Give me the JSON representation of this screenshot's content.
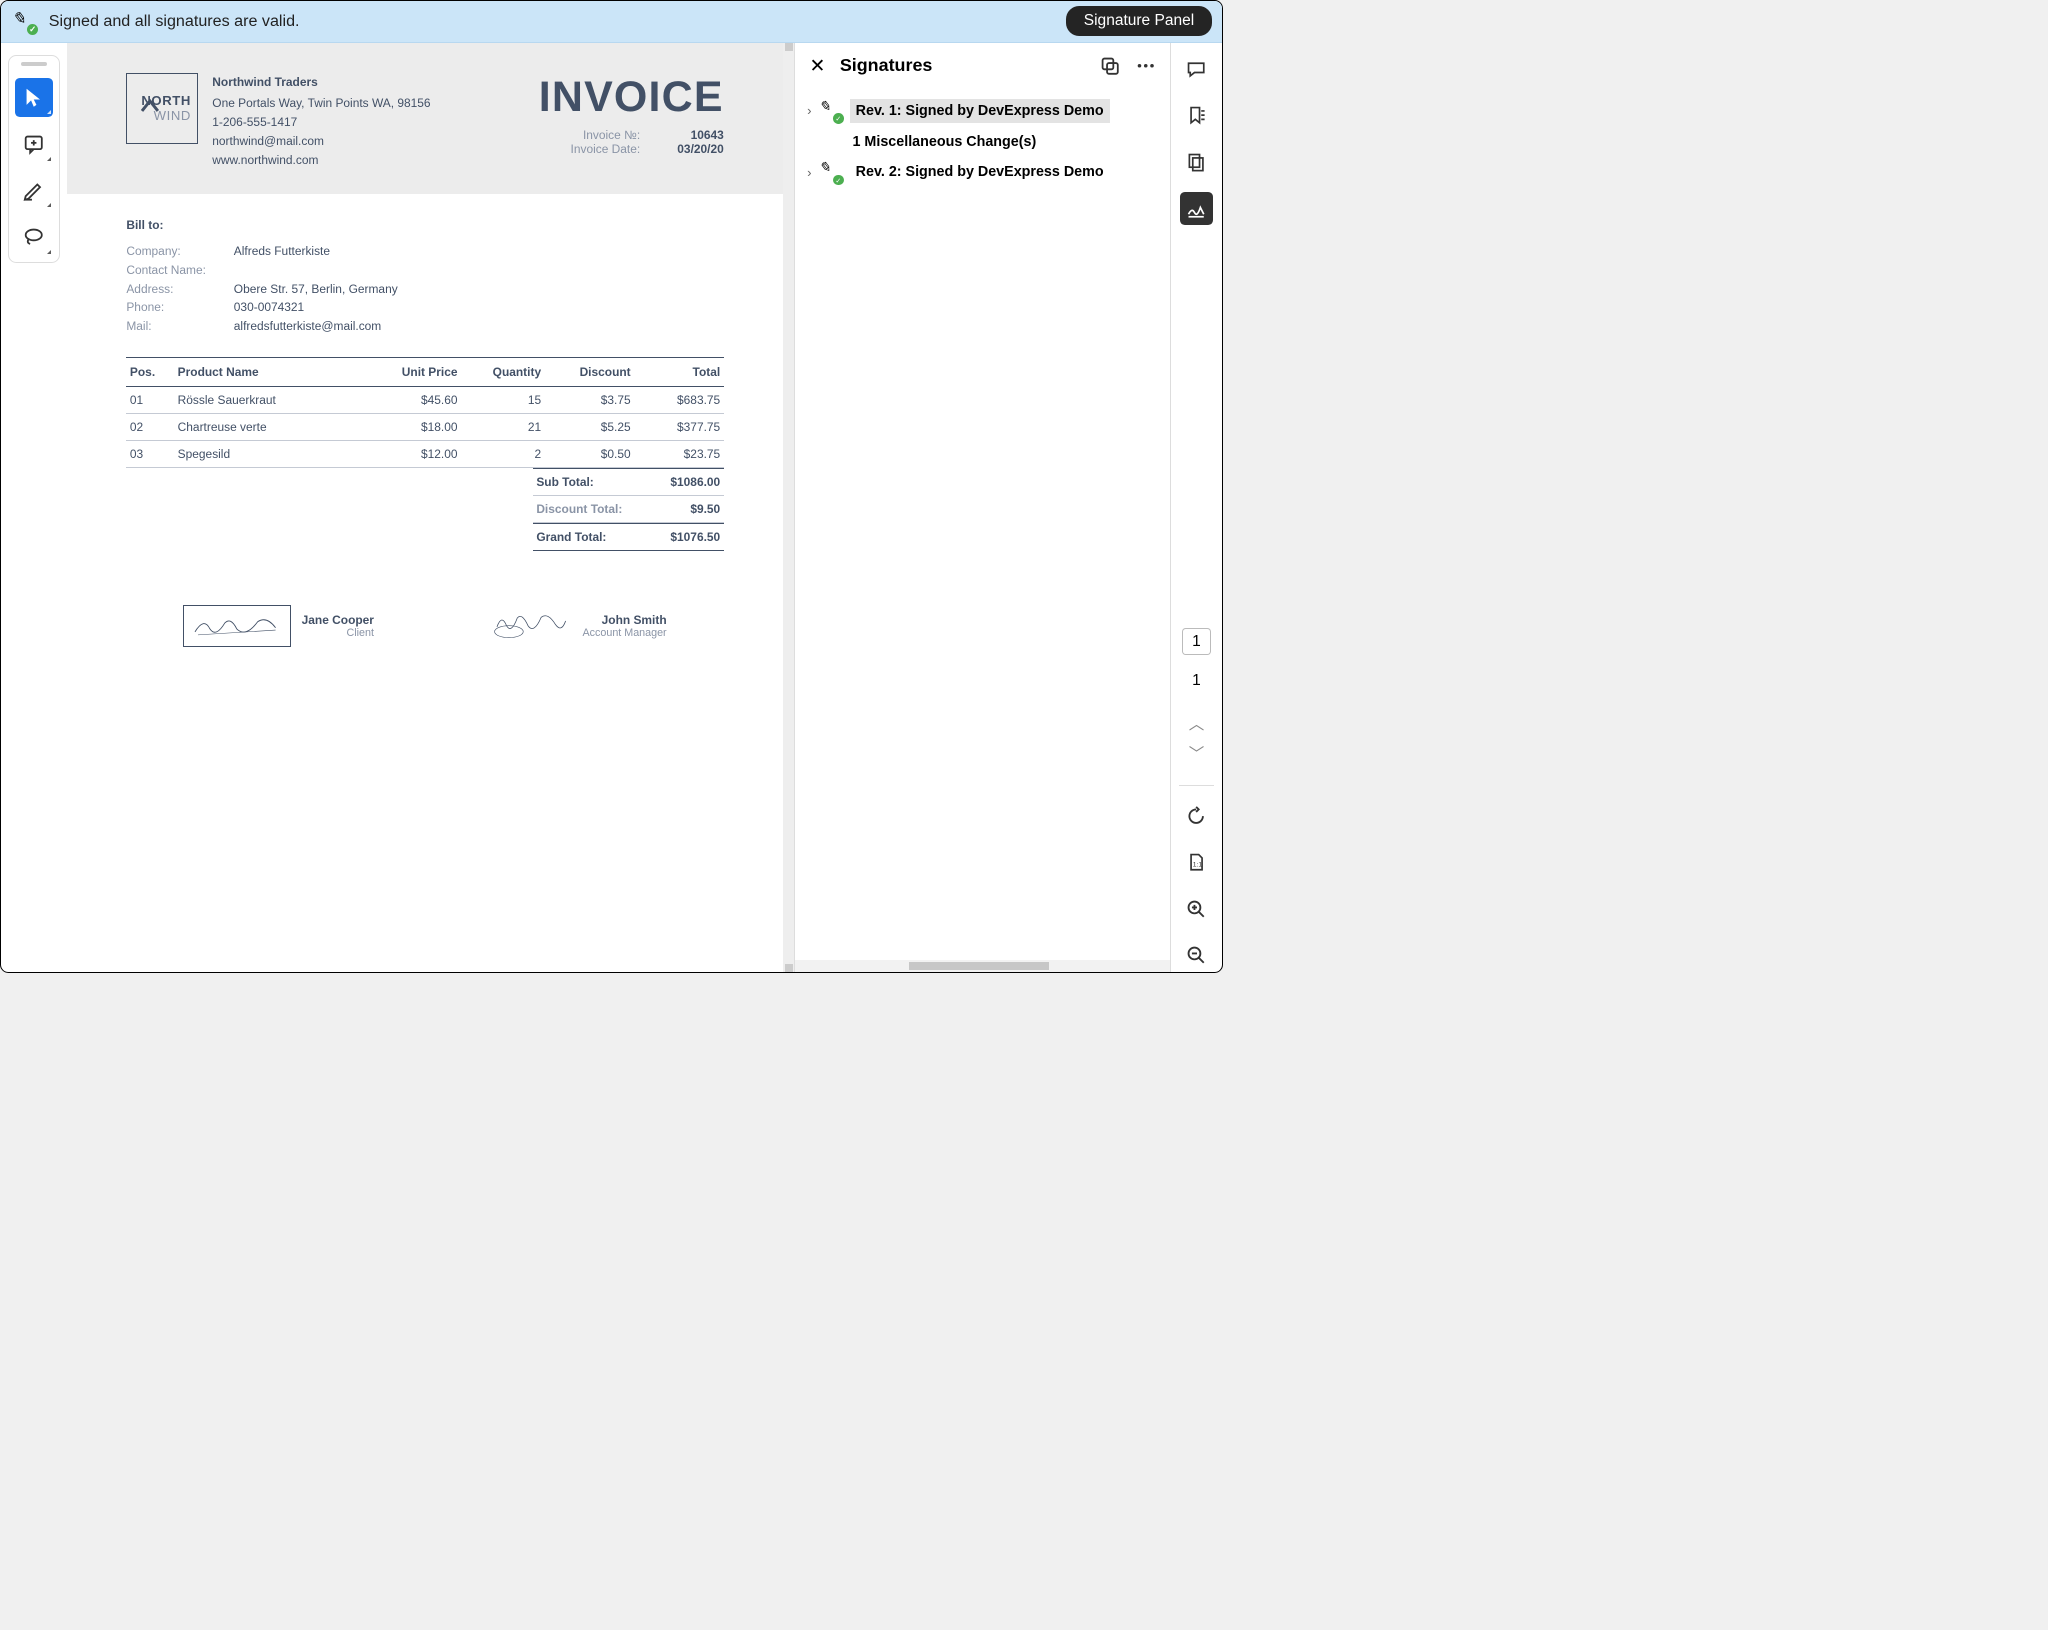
{
  "signature_bar": {
    "status": "Signed and all signatures are valid.",
    "panel_button": "Signature Panel"
  },
  "tools": [
    "select",
    "comment",
    "highlight",
    "lasso"
  ],
  "document": {
    "company": {
      "logo_line1": "NORTH",
      "logo_line2": "WIND",
      "name": "Northwind Traders",
      "address": "One Portals Way, Twin Points WA, 98156",
      "phone": "1-206-555-1417",
      "email": "northwind@mail.com",
      "website": "www.northwind.com"
    },
    "invoice_title": "INVOICE",
    "invoice_meta": {
      "number_label": "Invoice №:",
      "number": "10643",
      "date_label": "Invoice Date:",
      "date": "03/20/20"
    },
    "bill_to_label": "Bill to:",
    "bill_to": {
      "company_label": "Company:",
      "company": "Alfreds Futterkiste",
      "contact_label": "Contact Name:",
      "contact": "",
      "address_label": "Address:",
      "address": "Obere Str. 57, Berlin, Germany",
      "phone_label": "Phone:",
      "phone": "030-0074321",
      "mail_label": "Mail:",
      "mail": "alfredsfutterkiste@mail.com"
    },
    "table": {
      "headers": {
        "pos": "Pos.",
        "name": "Product Name",
        "price": "Unit Price",
        "qty": "Quantity",
        "discount": "Discount",
        "total": "Total"
      },
      "rows": [
        {
          "pos": "01",
          "name": "Rössle Sauerkraut",
          "price": "$45.60",
          "qty": "15",
          "discount": "$3.75",
          "total": "$683.75"
        },
        {
          "pos": "02",
          "name": "Chartreuse verte",
          "price": "$18.00",
          "qty": "21",
          "discount": "$5.25",
          "total": "$377.75"
        },
        {
          "pos": "03",
          "name": "Spegesild",
          "price": "$12.00",
          "qty": "2",
          "discount": "$0.50",
          "total": "$23.75"
        }
      ]
    },
    "totals": {
      "subtotal_label": "Sub Total:",
      "subtotal": "$1086.00",
      "discount_label": "Discount Total:",
      "discount": "$9.50",
      "grand_label": "Grand Total:",
      "grand": "$1076.50"
    },
    "signatures": {
      "left": {
        "name": "Jane Cooper",
        "role": "Client"
      },
      "right": {
        "name": "John Smith",
        "role": "Account Manager"
      }
    }
  },
  "panel": {
    "title": "Signatures",
    "items": [
      {
        "label": "Rev. 1: Signed by DevExpress Demo",
        "selected": true,
        "sub": "1 Miscellaneous Change(s)"
      },
      {
        "label": "Rev. 2: Signed by DevExpress Demo",
        "selected": false
      }
    ]
  },
  "rail": {
    "current_page": "1",
    "total_pages": "1"
  }
}
